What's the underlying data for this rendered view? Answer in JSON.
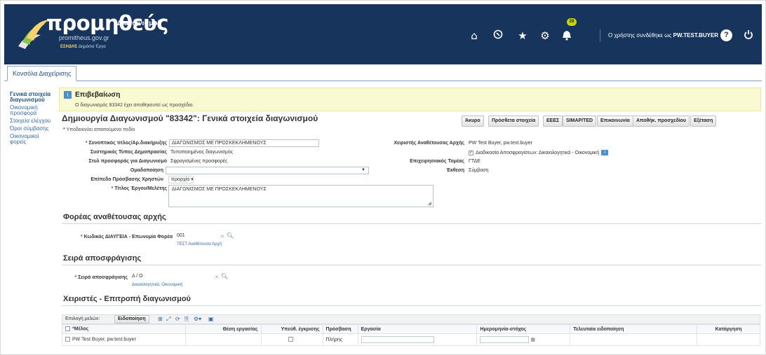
{
  "header": {
    "logo_word": "προμηθεύς",
    "logo_sub": "Διαγωνισμοί",
    "logo_url": "promitheus.gov.gr",
    "logo_esidis": "ΕΣΗΔΗΣ",
    "logo_esidis_sub": "Δημόσια Έργα",
    "notifications_count": "29",
    "user_prefix": "Ο χρήστης συνδέθηκε ως ",
    "user_name": "PW.TEST.BUYER",
    "icons": [
      "home-icon",
      "clock-icon",
      "star-icon",
      "gear-icon",
      "bell-icon",
      "help-icon",
      "power-icon"
    ]
  },
  "tabs": [
    {
      "label": "Κονσόλα Διαχείρισης"
    }
  ],
  "sidenav": [
    {
      "label": "Γενικά στοιχεία διαγωνισμού"
    },
    {
      "label": "Οικονομική προσφορά"
    },
    {
      "label": "Στοιχεία ελέγχου"
    },
    {
      "label": "Όροι σύμβασης"
    },
    {
      "label": "Οικονομικοί φορείς"
    }
  ],
  "confirmation": {
    "title": "Επιβεβαίωση",
    "message": "Ο διαγωνισμός 83342 έχει αποθηκευτεί ως προσχέδιο."
  },
  "page_title": "Δημιουργία Διαγωνισμού \"83342\": Γενικά στοιχεία διαγωνισμού",
  "buttons": {
    "cancel": "Άκυρο",
    "extra": "Πρόσθετα στοιχεία",
    "eeez": "ΕΕΕΣ",
    "simap": "SIMAP/TED",
    "contact": "Επικοινωνία",
    "save_draft": "Αποθήκ. προσχεδίου",
    "review": "Εξέταση"
  },
  "required_note": "Υποδεικνύει απαιτούμενο πεδίο",
  "form": {
    "title_label": "Συνοπτικός τίτλος/Αρ.διακήρυξης",
    "title_value": "ΔΙΑΓΩΝΙΣΜΟΣ ΜΕ ΠΡΟΣΚΕΚΛΗΜΕΝΟΥΣ",
    "system_type_label": "Συστημικός Τύπος Δημοπρασίας",
    "system_type_value": "Τυποποιημένος διαγωνισμός",
    "offer_style_label": "Στυλ προσφοράς για Διαγωνισμό",
    "offer_style_value": "Σφραγισμένες προσφορές",
    "grouping_label": "Ομαδοποίηση",
    "access_level_label": "Επίπεδο Πρόσβασης Χρηστών",
    "access_level_value": "Ιεραρχία",
    "work_title_label": "Τίτλος Έργου/Μελέτης",
    "work_title_value": "ΔΙΑΓΩΝΙΣΜΟΣ ΜΕ ΠΡΟΣΚΕΚΛΗΜΕΝΟΥΣ",
    "manager_label": "Χειριστής Αναθέτουσας Αρχής",
    "manager_value": "PW Test Buyer, pw.test.buyer",
    "unsealing_value": "Διαδικασία Αποσφραγίσεων: Δικαιολογητικά - Οικονομική",
    "sector_label": "Επιχειρησιακός Τομέας",
    "sector_value": "ΓΤΔΕ",
    "report_label": "Έκθεση",
    "report_value": "Σύμβαση"
  },
  "authority": {
    "section_title": "Φορέας αναθέτουσας αρχής",
    "code_label": "Κωδικός ΔΙΑΥΓΕΙΑ - Επωνυμία Φορέα",
    "code_value": "001",
    "code_sub": "ΤΕΣΤ Αναθέτουσα Αρχή"
  },
  "unsealing": {
    "section_title": "Σειρά αποσφράγισης",
    "order_label": "Σειρά αποσφράγισης",
    "order_value": "Δ / Ο",
    "order_sub": "Δικαιολογητικά, Οικονομική"
  },
  "committee": {
    "section_title": "Χειριστές - Επιτροπή διαγωνισμού",
    "select_label": "Επιλογή μελών:",
    "notify_button": "Ειδοποίηση",
    "columns": [
      "Μέλος",
      "Θέση εργασίας",
      "Υπεύθ. έγκρισης",
      "Πρόσβαση",
      "Εργασία",
      "Ημερομηνία-στόχος",
      "Τελευταία ειδοποίηση",
      "Κατάργηση"
    ],
    "rows": [
      {
        "member": "PW Test Buyer, pw.test.buyer",
        "position": "",
        "access": "Πλήρης"
      }
    ]
  }
}
